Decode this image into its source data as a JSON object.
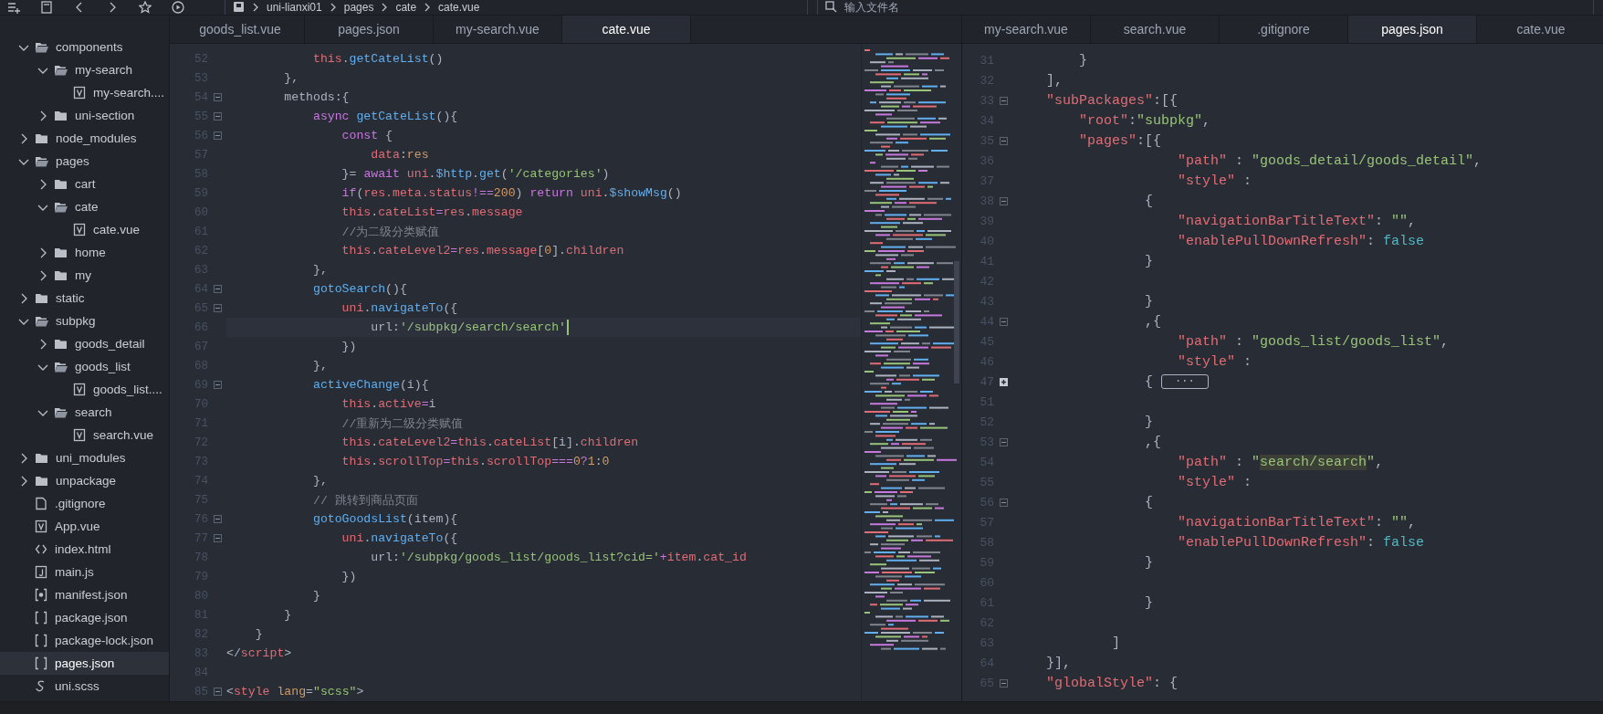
{
  "toolbar": {
    "breadcrumb": [
      "uni-lianxi01",
      "pages",
      "cate",
      "cate.vue"
    ],
    "search": {
      "placeholder": "输入文件名"
    }
  },
  "sidebar": {
    "tree": [
      {
        "label": "components",
        "kind": "folder",
        "expanded": true,
        "selected": false,
        "children": [
          {
            "label": "my-search",
            "kind": "folder",
            "expanded": true,
            "selected": false,
            "children": [
              {
                "label": "my-search....",
                "kind": "vue",
                "selected": false
              }
            ]
          },
          {
            "label": "uni-section",
            "kind": "folder",
            "expanded": false,
            "selected": false
          }
        ]
      },
      {
        "label": "node_modules",
        "kind": "folder",
        "expanded": false,
        "selected": false
      },
      {
        "label": "pages",
        "kind": "folder",
        "expanded": true,
        "selected": false,
        "children": [
          {
            "label": "cart",
            "kind": "folder",
            "expanded": false,
            "selected": false
          },
          {
            "label": "cate",
            "kind": "folder",
            "expanded": true,
            "selected": false,
            "children": [
              {
                "label": "cate.vue",
                "kind": "vue",
                "selected": false
              }
            ]
          },
          {
            "label": "home",
            "kind": "folder",
            "expanded": false,
            "selected": false
          },
          {
            "label": "my",
            "kind": "folder",
            "expanded": false,
            "selected": false
          }
        ]
      },
      {
        "label": "static",
        "kind": "folder",
        "expanded": false,
        "selected": false
      },
      {
        "label": "subpkg",
        "kind": "folder",
        "expanded": true,
        "selected": false,
        "children": [
          {
            "label": "goods_detail",
            "kind": "folder",
            "expanded": false,
            "selected": false
          },
          {
            "label": "goods_list",
            "kind": "folder",
            "expanded": true,
            "selected": false,
            "children": [
              {
                "label": "goods_list....",
                "kind": "vue",
                "selected": false
              }
            ]
          },
          {
            "label": "search",
            "kind": "folder",
            "expanded": true,
            "selected": false,
            "children": [
              {
                "label": "search.vue",
                "kind": "vue",
                "selected": false
              }
            ]
          }
        ]
      },
      {
        "label": "uni_modules",
        "kind": "folder",
        "expanded": false,
        "selected": false
      },
      {
        "label": "unpackage",
        "kind": "folder",
        "expanded": false,
        "selected": false
      },
      {
        "label": ".gitignore",
        "kind": "file",
        "selected": false
      },
      {
        "label": "App.vue",
        "kind": "vue",
        "selected": false
      },
      {
        "label": "index.html",
        "kind": "html",
        "selected": false
      },
      {
        "label": "main.js",
        "kind": "js",
        "selected": false
      },
      {
        "label": "manifest.json",
        "kind": "manifest",
        "selected": false
      },
      {
        "label": "package.json",
        "kind": "json",
        "selected": false
      },
      {
        "label": "package-lock.json",
        "kind": "json",
        "selected": false
      },
      {
        "label": "pages.json",
        "kind": "json",
        "selected": true
      },
      {
        "label": "uni.scss",
        "kind": "scss",
        "selected": false
      }
    ]
  },
  "editors": [
    {
      "tabs": [
        {
          "label": "goods_list.vue",
          "selected": false
        },
        {
          "label": "pages.json",
          "selected": false
        },
        {
          "label": "my-search.vue",
          "selected": false
        },
        {
          "label": "cate.vue",
          "selected": true
        }
      ],
      "lines": [
        {
          "number": "52",
          "foldable": false,
          "collapsed": false,
          "current": false,
          "tokens": [
            {
              "kind": "var",
              "text": "            this"
            },
            {
              "kind": "plain",
              "text": "."
            },
            {
              "kind": "fn",
              "text": "getCateList"
            },
            {
              "kind": "plain",
              "text": "()"
            }
          ]
        },
        {
          "number": "53",
          "foldable": false,
          "collapsed": false,
          "current": false,
          "tokens": [
            {
              "kind": "plain",
              "text": "        },"
            }
          ]
        },
        {
          "number": "54",
          "foldable": true,
          "collapsed": false,
          "current": false,
          "tokens": [
            {
              "kind": "plain",
              "text": "        methods:{"
            }
          ]
        },
        {
          "number": "55",
          "foldable": true,
          "collapsed": false,
          "current": false,
          "tokens": [
            {
              "kind": "kw",
              "text": "            async "
            },
            {
              "kind": "fn",
              "text": "getCateList"
            },
            {
              "kind": "plain",
              "text": "(){"
            }
          ]
        },
        {
          "number": "56",
          "foldable": true,
          "collapsed": false,
          "current": false,
          "tokens": [
            {
              "kind": "kw",
              "text": "                const"
            },
            {
              "kind": "plain",
              "text": " {"
            }
          ]
        },
        {
          "number": "57",
          "foldable": false,
          "collapsed": false,
          "current": false,
          "tokens": [
            {
              "kind": "var",
              "text": "                    data"
            },
            {
              "kind": "plain",
              "text": ":"
            },
            {
              "kind": "num",
              "text": "res"
            }
          ]
        },
        {
          "number": "58",
          "foldable": false,
          "collapsed": false,
          "current": false,
          "tokens": [
            {
              "kind": "plain",
              "text": "                }= "
            },
            {
              "kind": "kw",
              "text": "await "
            },
            {
              "kind": "var",
              "text": "uni"
            },
            {
              "kind": "plain",
              "text": "."
            },
            {
              "kind": "fn",
              "text": "$http"
            },
            {
              "kind": "plain",
              "text": "."
            },
            {
              "kind": "fn",
              "text": "get"
            },
            {
              "kind": "plain",
              "text": "("
            },
            {
              "kind": "str",
              "text": "'/categories'"
            },
            {
              "kind": "plain",
              "text": ")"
            }
          ]
        },
        {
          "number": "59",
          "foldable": false,
          "collapsed": false,
          "current": false,
          "tokens": [
            {
              "kind": "kw",
              "text": "                if"
            },
            {
              "kind": "plain",
              "text": "("
            },
            {
              "kind": "var",
              "text": "res.meta.status"
            },
            {
              "kind": "kw",
              "text": "!=="
            },
            {
              "kind": "num",
              "text": "200"
            },
            {
              "kind": "plain",
              "text": ") "
            },
            {
              "kind": "kw",
              "text": "return "
            },
            {
              "kind": "var",
              "text": "uni"
            },
            {
              "kind": "plain",
              "text": "."
            },
            {
              "kind": "fn",
              "text": "$showMsg"
            },
            {
              "kind": "plain",
              "text": "()"
            }
          ]
        },
        {
          "number": "60",
          "foldable": false,
          "collapsed": false,
          "current": false,
          "tokens": [
            {
              "kind": "var",
              "text": "                this"
            },
            {
              "kind": "plain",
              "text": "."
            },
            {
              "kind": "var",
              "text": "cateList"
            },
            {
              "kind": "kw",
              "text": "="
            },
            {
              "kind": "var",
              "text": "res"
            },
            {
              "kind": "plain",
              "text": "."
            },
            {
              "kind": "var",
              "text": "message"
            }
          ]
        },
        {
          "number": "61",
          "foldable": false,
          "collapsed": false,
          "current": false,
          "tokens": [
            {
              "kind": "com",
              "text": "                //为二级分类赋值"
            }
          ]
        },
        {
          "number": "62",
          "foldable": false,
          "collapsed": false,
          "current": false,
          "tokens": [
            {
              "kind": "var",
              "text": "                this"
            },
            {
              "kind": "plain",
              "text": "."
            },
            {
              "kind": "var",
              "text": "cateLevel2"
            },
            {
              "kind": "kw",
              "text": "="
            },
            {
              "kind": "var",
              "text": "res"
            },
            {
              "kind": "plain",
              "text": "."
            },
            {
              "kind": "var",
              "text": "message"
            },
            {
              "kind": "plain",
              "text": "["
            },
            {
              "kind": "num",
              "text": "0"
            },
            {
              "kind": "plain",
              "text": "]."
            },
            {
              "kind": "var",
              "text": "children"
            }
          ]
        },
        {
          "number": "63",
          "foldable": false,
          "collapsed": false,
          "current": false,
          "tokens": [
            {
              "kind": "plain",
              "text": "            },"
            }
          ]
        },
        {
          "number": "64",
          "foldable": true,
          "collapsed": false,
          "current": false,
          "tokens": [
            {
              "kind": "fn",
              "text": "            gotoSearch"
            },
            {
              "kind": "plain",
              "text": "(){"
            }
          ]
        },
        {
          "number": "65",
          "foldable": true,
          "collapsed": false,
          "current": false,
          "tokens": [
            {
              "kind": "var",
              "text": "                uni"
            },
            {
              "kind": "plain",
              "text": "."
            },
            {
              "kind": "fn",
              "text": "navigateTo"
            },
            {
              "kind": "plain",
              "text": "({"
            }
          ]
        },
        {
          "number": "66",
          "foldable": false,
          "collapsed": false,
          "current": true,
          "tokens": [
            {
              "kind": "plain",
              "text": "                    url:"
            },
            {
              "kind": "str",
              "text": "'/subpkg/search/search'"
            }
          ]
        },
        {
          "number": "67",
          "foldable": false,
          "collapsed": false,
          "current": false,
          "tokens": [
            {
              "kind": "plain",
              "text": "                })"
            }
          ]
        },
        {
          "number": "68",
          "foldable": false,
          "collapsed": false,
          "current": false,
          "tokens": [
            {
              "kind": "plain",
              "text": "            },"
            }
          ]
        },
        {
          "number": "69",
          "foldable": true,
          "collapsed": false,
          "current": false,
          "tokens": [
            {
              "kind": "fn",
              "text": "            activeChange"
            },
            {
              "kind": "plain",
              "text": "(i){"
            }
          ]
        },
        {
          "number": "70",
          "foldable": false,
          "collapsed": false,
          "current": false,
          "tokens": [
            {
              "kind": "var",
              "text": "                this"
            },
            {
              "kind": "plain",
              "text": "."
            },
            {
              "kind": "var",
              "text": "active"
            },
            {
              "kind": "kw",
              "text": "="
            },
            {
              "kind": "plain",
              "text": "i"
            }
          ]
        },
        {
          "number": "71",
          "foldable": false,
          "collapsed": false,
          "current": false,
          "tokens": [
            {
              "kind": "com",
              "text": "                //重新为二级分类赋值"
            }
          ]
        },
        {
          "number": "72",
          "foldable": false,
          "collapsed": false,
          "current": false,
          "tokens": [
            {
              "kind": "var",
              "text": "                this"
            },
            {
              "kind": "plain",
              "text": "."
            },
            {
              "kind": "var",
              "text": "cateLevel2"
            },
            {
              "kind": "kw",
              "text": "="
            },
            {
              "kind": "var",
              "text": "this"
            },
            {
              "kind": "plain",
              "text": "."
            },
            {
              "kind": "var",
              "text": "cateList"
            },
            {
              "kind": "plain",
              "text": "[i]."
            },
            {
              "kind": "var",
              "text": "children"
            }
          ]
        },
        {
          "number": "73",
          "foldable": false,
          "collapsed": false,
          "current": false,
          "tokens": [
            {
              "kind": "var",
              "text": "                this"
            },
            {
              "kind": "plain",
              "text": "."
            },
            {
              "kind": "var",
              "text": "scrollTop"
            },
            {
              "kind": "kw",
              "text": "="
            },
            {
              "kind": "var",
              "text": "this"
            },
            {
              "kind": "plain",
              "text": "."
            },
            {
              "kind": "var",
              "text": "scrollTop"
            },
            {
              "kind": "kw",
              "text": "==="
            },
            {
              "kind": "num",
              "text": "0"
            },
            {
              "kind": "kw",
              "text": "?"
            },
            {
              "kind": "num",
              "text": "1"
            },
            {
              "kind": "plain",
              "text": ":"
            },
            {
              "kind": "num",
              "text": "0"
            }
          ]
        },
        {
          "number": "74",
          "foldable": false,
          "collapsed": false,
          "current": false,
          "tokens": [
            {
              "kind": "plain",
              "text": "            },"
            }
          ]
        },
        {
          "number": "75",
          "foldable": false,
          "collapsed": false,
          "current": false,
          "tokens": [
            {
              "kind": "com",
              "text": "            // 跳转到商品页面"
            }
          ]
        },
        {
          "number": "76",
          "foldable": true,
          "collapsed": false,
          "current": false,
          "tokens": [
            {
              "kind": "fn",
              "text": "            gotoGoodsList"
            },
            {
              "kind": "plain",
              "text": "(item){"
            }
          ]
        },
        {
          "number": "77",
          "foldable": true,
          "collapsed": false,
          "current": false,
          "tokens": [
            {
              "kind": "var",
              "text": "                uni"
            },
            {
              "kind": "plain",
              "text": "."
            },
            {
              "kind": "fn",
              "text": "navigateTo"
            },
            {
              "kind": "plain",
              "text": "({"
            }
          ]
        },
        {
          "number": "78",
          "foldable": false,
          "collapsed": false,
          "current": false,
          "tokens": [
            {
              "kind": "plain",
              "text": "                    url:"
            },
            {
              "kind": "str",
              "text": "'/subpkg/goods_list/goods_list?cid='"
            },
            {
              "kind": "kw",
              "text": "+"
            },
            {
              "kind": "var",
              "text": "item"
            },
            {
              "kind": "plain",
              "text": "."
            },
            {
              "kind": "var",
              "text": "cat_id"
            }
          ]
        },
        {
          "number": "79",
          "foldable": false,
          "collapsed": false,
          "current": false,
          "tokens": [
            {
              "kind": "plain",
              "text": "                })"
            }
          ]
        },
        {
          "number": "80",
          "foldable": false,
          "collapsed": false,
          "current": false,
          "tokens": [
            {
              "kind": "plain",
              "text": "            }"
            }
          ]
        },
        {
          "number": "81",
          "foldable": false,
          "collapsed": false,
          "current": false,
          "tokens": [
            {
              "kind": "plain",
              "text": "        }"
            }
          ]
        },
        {
          "number": "82",
          "foldable": false,
          "collapsed": false,
          "current": false,
          "tokens": [
            {
              "kind": "plain",
              "text": "    }"
            }
          ]
        },
        {
          "number": "83",
          "foldable": false,
          "collapsed": false,
          "current": false,
          "tokens": [
            {
              "kind": "plain",
              "text": "</"
            },
            {
              "kind": "var",
              "text": "script"
            },
            {
              "kind": "plain",
              "text": ">"
            }
          ]
        },
        {
          "number": "84",
          "foldable": false,
          "collapsed": false,
          "current": false
        },
        {
          "number": "85",
          "foldable": true,
          "collapsed": false,
          "current": false,
          "tokens": [
            {
              "kind": "plain",
              "text": "<"
            },
            {
              "kind": "var",
              "text": "style "
            },
            {
              "kind": "num",
              "text": "lang"
            },
            {
              "kind": "plain",
              "text": "="
            },
            {
              "kind": "str",
              "text": "\"scss\""
            },
            {
              "kind": "plain",
              "text": ">"
            }
          ]
        }
      ]
    },
    {
      "tabs": [
        {
          "label": "my-search.vue",
          "selected": false
        },
        {
          "label": "search.vue",
          "selected": false
        },
        {
          "label": ".gitignore",
          "selected": false
        },
        {
          "label": "pages.json",
          "selected": true
        },
        {
          "label": "cate.vue",
          "selected": false
        }
      ],
      "lines": [
        {
          "number": "31",
          "foldable": false,
          "collapsed": false,
          "current": false,
          "tokens": [
            {
              "kind": "plain",
              "text": "        }"
            }
          ]
        },
        {
          "number": "32",
          "foldable": false,
          "collapsed": false,
          "current": false,
          "tokens": [
            {
              "kind": "plain",
              "text": "    ],"
            }
          ]
        },
        {
          "number": "33",
          "foldable": true,
          "collapsed": false,
          "current": false,
          "tokens": [
            {
              "kind": "var",
              "text": "    \"subPackages\""
            },
            {
              "kind": "plain",
              "text": ":[{"
            }
          ]
        },
        {
          "number": "34",
          "foldable": false,
          "collapsed": false,
          "current": false,
          "tokens": [
            {
              "kind": "var",
              "text": "        \"root\""
            },
            {
              "kind": "plain",
              "text": ":"
            },
            {
              "kind": "str",
              "text": "\"subpkg\""
            },
            {
              "kind": "plain",
              "text": ","
            }
          ]
        },
        {
          "number": "35",
          "foldable": true,
          "collapsed": false,
          "current": false,
          "tokens": [
            {
              "kind": "var",
              "text": "        \"pages\""
            },
            {
              "kind": "plain",
              "text": ":[{"
            }
          ]
        },
        {
          "number": "36",
          "foldable": false,
          "collapsed": false,
          "current": false,
          "tokens": [
            {
              "kind": "var",
              "text": "                    \"path\""
            },
            {
              "kind": "plain",
              "text": " : "
            },
            {
              "kind": "str",
              "text": "\"goods_detail/goods_detail\""
            },
            {
              "kind": "plain",
              "text": ","
            }
          ]
        },
        {
          "number": "37",
          "foldable": false,
          "collapsed": false,
          "current": false,
          "tokens": [
            {
              "kind": "var",
              "text": "                    \"style\""
            },
            {
              "kind": "plain",
              "text": " :"
            }
          ]
        },
        {
          "number": "38",
          "foldable": true,
          "collapsed": false,
          "current": false,
          "tokens": [
            {
              "kind": "plain",
              "text": "                {"
            }
          ]
        },
        {
          "number": "39",
          "foldable": false,
          "collapsed": false,
          "current": false,
          "tokens": [
            {
              "kind": "var",
              "text": "                    \"navigationBarTitleText\""
            },
            {
              "kind": "plain",
              "text": ": "
            },
            {
              "kind": "str",
              "text": "\"\""
            },
            {
              "kind": "plain",
              "text": ","
            }
          ]
        },
        {
          "number": "40",
          "foldable": false,
          "collapsed": false,
          "current": false,
          "tokens": [
            {
              "kind": "var",
              "text": "                    \"enablePullDownRefresh\""
            },
            {
              "kind": "plain",
              "text": ": "
            },
            {
              "kind": "const",
              "text": "false"
            }
          ]
        },
        {
          "number": "41",
          "foldable": false,
          "collapsed": false,
          "current": false,
          "tokens": [
            {
              "kind": "plain",
              "text": "                }"
            }
          ]
        },
        {
          "number": "42",
          "foldable": false,
          "collapsed": false,
          "current": false
        },
        {
          "number": "43",
          "foldable": false,
          "collapsed": false,
          "current": false,
          "tokens": [
            {
              "kind": "plain",
              "text": "                }"
            }
          ]
        },
        {
          "number": "44",
          "foldable": true,
          "collapsed": false,
          "current": false,
          "tokens": [
            {
              "kind": "plain",
              "text": "                ,{"
            }
          ]
        },
        {
          "number": "45",
          "foldable": false,
          "collapsed": false,
          "current": false,
          "tokens": [
            {
              "kind": "var",
              "text": "                    \"path\""
            },
            {
              "kind": "plain",
              "text": " : "
            },
            {
              "kind": "str",
              "text": "\"goods_list/goods_list\""
            },
            {
              "kind": "plain",
              "text": ","
            }
          ]
        },
        {
          "number": "46",
          "foldable": false,
          "collapsed": false,
          "current": false,
          "tokens": [
            {
              "kind": "var",
              "text": "                    \"style\""
            },
            {
              "kind": "plain",
              "text": " :"
            }
          ]
        },
        {
          "number": "47",
          "foldable": true,
          "collapsed": true,
          "current": false,
          "tokens": [
            {
              "kind": "plain",
              "text": "                {"
            },
            {
              "kind": "folded",
              "text": "···"
            }
          ]
        },
        {
          "number": "51",
          "foldable": false,
          "collapsed": false,
          "current": false
        },
        {
          "number": "52",
          "foldable": false,
          "collapsed": false,
          "current": false,
          "tokens": [
            {
              "kind": "plain",
              "text": "                }"
            }
          ]
        },
        {
          "number": "53",
          "foldable": true,
          "collapsed": false,
          "current": false,
          "tokens": [
            {
              "kind": "plain",
              "text": "                ,{"
            }
          ]
        },
        {
          "number": "54",
          "foldable": false,
          "collapsed": false,
          "current": false,
          "tokens": [
            {
              "kind": "var",
              "text": "                    \"path\""
            },
            {
              "kind": "plain",
              "text": " : "
            },
            {
              "kind": "str",
              "text": "\""
            },
            {
              "kind": "match",
              "text": "search/search"
            },
            {
              "kind": "str",
              "text": "\""
            },
            {
              "kind": "plain",
              "text": ","
            }
          ]
        },
        {
          "number": "55",
          "foldable": false,
          "collapsed": false,
          "current": false,
          "tokens": [
            {
              "kind": "var",
              "text": "                    \"style\""
            },
            {
              "kind": "plain",
              "text": " :"
            }
          ]
        },
        {
          "number": "56",
          "foldable": true,
          "collapsed": false,
          "current": false,
          "tokens": [
            {
              "kind": "plain",
              "text": "                {"
            }
          ]
        },
        {
          "number": "57",
          "foldable": false,
          "collapsed": false,
          "current": false,
          "tokens": [
            {
              "kind": "var",
              "text": "                    \"navigationBarTitleText\""
            },
            {
              "kind": "plain",
              "text": ": "
            },
            {
              "kind": "str",
              "text": "\"\""
            },
            {
              "kind": "plain",
              "text": ","
            }
          ]
        },
        {
          "number": "58",
          "foldable": false,
          "collapsed": false,
          "current": false,
          "tokens": [
            {
              "kind": "var",
              "text": "                    \"enablePullDownRefresh\""
            },
            {
              "kind": "plain",
              "text": ": "
            },
            {
              "kind": "const",
              "text": "false"
            }
          ]
        },
        {
          "number": "59",
          "foldable": false,
          "collapsed": false,
          "current": false,
          "tokens": [
            {
              "kind": "plain",
              "text": "                }"
            }
          ]
        },
        {
          "number": "60",
          "foldable": false,
          "collapsed": false,
          "current": false
        },
        {
          "number": "61",
          "foldable": false,
          "collapsed": false,
          "current": false,
          "tokens": [
            {
              "kind": "plain",
              "text": "                }"
            }
          ]
        },
        {
          "number": "62",
          "foldable": false,
          "collapsed": false,
          "current": false
        },
        {
          "number": "63",
          "foldable": false,
          "collapsed": false,
          "current": false,
          "tokens": [
            {
              "kind": "plain",
              "text": "            ]"
            }
          ]
        },
        {
          "number": "64",
          "foldable": false,
          "collapsed": false,
          "current": false,
          "tokens": [
            {
              "kind": "plain",
              "text": "    }],"
            }
          ]
        },
        {
          "number": "65",
          "foldable": true,
          "collapsed": false,
          "current": false,
          "tokens": [
            {
              "kind": "var",
              "text": "    \"globalStyle\""
            },
            {
              "kind": "plain",
              "text": ": {"
            }
          ]
        }
      ]
    }
  ]
}
